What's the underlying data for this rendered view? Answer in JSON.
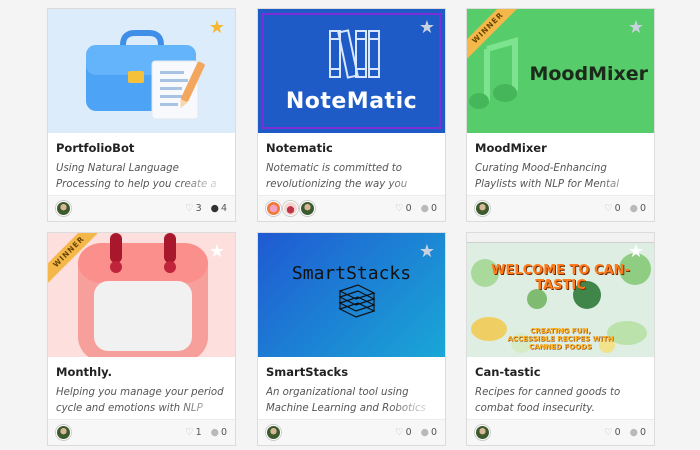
{
  "projects": [
    {
      "title": "PortfolioBot",
      "description": "Using Natural Language Processing to help you create a beautiful and",
      "likes": "3",
      "comments": "4",
      "starred": true,
      "winner": false
    },
    {
      "title": "Notematic",
      "description": "Notematic is committed to revolutionizing the way you study and",
      "likes": "0",
      "comments": "0",
      "starred": false,
      "winner": false,
      "brand": "NoteMatic"
    },
    {
      "title": "MoodMixer",
      "description": "Curating Mood-Enhancing Playlists with NLP for Mental Health",
      "likes": "0",
      "comments": "0",
      "starred": false,
      "winner": true,
      "ribbon": "WINNER",
      "brand": "MoodMixer"
    },
    {
      "title": "Monthly.",
      "description": "Helping you manage your period cycle and emotions with NLP",
      "likes": "1",
      "comments": "0",
      "starred": false,
      "winner": true,
      "ribbon": "WINNER"
    },
    {
      "title": "SmartStacks",
      "description": "An organizational tool using Machine Learning and Robotics to sort your",
      "likes": "0",
      "comments": "0",
      "starred": false,
      "winner": false,
      "brand": "SmartStacks"
    },
    {
      "title": "Can-tastic",
      "description": "Recipes for canned goods to combat food insecurity. (Honorable Mention",
      "likes": "0",
      "comments": "0",
      "starred": false,
      "winner": false,
      "brand": "WELCOME TO CAN-TASTIC",
      "subbrand": "CREATING FUN, ACCESSIBLE RECIPES WITH CANNED FOODS"
    }
  ],
  "colors": {
    "star_active": "#f5b731",
    "star_inactive": "#c9d3df",
    "ribbon": "#f4b84a"
  }
}
